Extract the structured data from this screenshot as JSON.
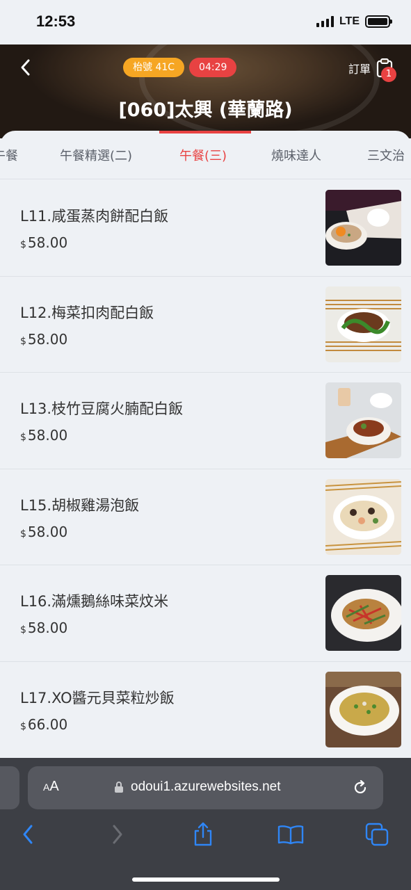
{
  "status_bar": {
    "time": "12:53",
    "network": "LTE"
  },
  "header": {
    "table_badge": "枱號 41C",
    "timer_badge": "04:29",
    "order_label": "訂單",
    "order_count": "1",
    "store_title": "[060]太興 (華蘭路)"
  },
  "tabs": [
    "午餐",
    "午餐精選(二)",
    "午餐(三)",
    "燒味達人",
    "三文治"
  ],
  "active_tab": "午餐(三)",
  "currency_symbol": "$",
  "menu_items": [
    {
      "name": "L11.咸蛋蒸肉餅配白飯",
      "price": "58.00"
    },
    {
      "name": "L12.梅菜扣肉配白飯",
      "price": "58.00"
    },
    {
      "name": "L13.枝竹豆腐火腩配白飯",
      "price": "58.00"
    },
    {
      "name": "L15.胡椒雞湯泡飯",
      "price": "58.00"
    },
    {
      "name": "L16.滿燻鵝絲味菜炆米",
      "price": "58.00"
    },
    {
      "name": "L17.XO醬元貝菜粒炒飯",
      "price": "66.00"
    }
  ],
  "browser": {
    "text_size_label": "AA",
    "url": "odoui1.azurewebsites.net"
  },
  "colors": {
    "accent": "#e84242",
    "table_badge": "#f6a623",
    "background": "#eef1f5",
    "browser_bar": "#3d3f45",
    "ios_blue": "#2f86f6"
  }
}
